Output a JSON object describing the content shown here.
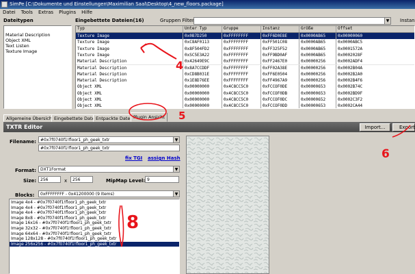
{
  "window": {
    "title": "SimPe [C:\\Dokumente und Einstellungen\\Maximilian Saal\\Desktop\\4_new_floors.package]"
  },
  "menu": [
    "Datei",
    "Tools",
    "Extras",
    "Plugins",
    "Hilfe"
  ],
  "left_panel": {
    "header": "Dateitypen",
    "items": [
      "Material Description",
      "Object XML",
      "Text Listen",
      "Texture Image"
    ]
  },
  "resources": {
    "header": "Eingebettete Dateien",
    "count": "(16)",
    "filter_label": "Gruppen Filter:",
    "filter_value": "",
    "right_label": "Instanz",
    "columns": [
      "Typ",
      "Unter Typ",
      "Gruppe",
      "Instanz",
      "Größe",
      "Offset"
    ],
    "rows": [
      [
        "Texture Image",
        "0x0B7D250",
        "0xFFFFFFFF",
        "0xFF6D0E8E",
        "0x0000AB65",
        "0x00000060"
      ],
      [
        "Texture Image",
        "0xC8AF0113",
        "0xFFFFFFFF",
        "0xFF501C08",
        "0x0000AB65",
        "0x0000ABC5"
      ],
      [
        "Texture Image",
        "0x8F504FD2",
        "0xFFFFFFFF",
        "0xFF325F52",
        "0x0000AB65",
        "0x0001572A"
      ],
      [
        "Texture Image",
        "0xSC5E3A22",
        "0xFFFFFFFF",
        "0xFF9BD0AF",
        "0x0000AB65",
        "0x0002028F"
      ],
      [
        "Material Description",
        "0x42649E9C",
        "0xFFFFFFFF",
        "0xFF2467E0",
        "0x00000256",
        "0x0002ADF4"
      ],
      [
        "Material Description",
        "0x8A7CCDDF",
        "0xFFFFFFFF",
        "0xFF02A38E",
        "0x00000256",
        "0x0002B04A"
      ],
      [
        "Material Description",
        "0xCD8B031E",
        "0xFFFFFFFF",
        "0xFF6E0504",
        "0x00000256",
        "0x0002B2A0"
      ],
      [
        "Material Description",
        "0x1E8D76EE",
        "0xFFFFFFFF",
        "0xFF4967A9",
        "0x00000256",
        "0x0002B4F6"
      ],
      [
        "Object XML",
        "0x00000000",
        "0x4C8CC5C0",
        "0xFCCOF0DE",
        "0x00000653",
        "0x0002B74C"
      ],
      [
        "Object XML",
        "0x00000000",
        "0x4C8CC5C0",
        "0xFCCOF0DB",
        "0x00000653",
        "0x0002BD9F"
      ],
      [
        "Object XML",
        "0x00000000",
        "0x4C8CC5C0",
        "0xFCCOF0DC",
        "0x00000652",
        "0x0002C3F2"
      ],
      [
        "Object XML",
        "0x00000000",
        "0x4C8CC5C0",
        "0xFCCOF0DD",
        "0x00000653",
        "0x0002CA44"
      ]
    ]
  },
  "tabs": [
    "Allgemeine Übersicht",
    "Eingebettete Datei",
    "Entpackte Datei",
    "Plugin Ansicht"
  ],
  "editor": {
    "title": "TXTR Editor",
    "import_label": "Import...",
    "export_label": "Export",
    "filename_label": "Filename:",
    "filename_value": "#0x7f0740f1!floor1_ph_geek_txtr",
    "filename_value2": "#0x7f0740f1!floor1_ph_geek_txtr",
    "fix_tgi": "fix TGI",
    "assign_hash": "assign Hash",
    "format_label": "Format:",
    "format_value": "DXT1Format",
    "size_label": "Size:",
    "size_w": "256",
    "size_x": "x",
    "size_h": "256",
    "mipmap_label": "MipMap Level:",
    "mipmap_value": "9",
    "blocks_label": "Blocks:",
    "blocks_value": "0xFFFFFFFF - 0x41200000 (9 Items)",
    "block_items": [
      "Image 4x4 - #0x7f0740f1!floor1_ph_geek_txtr",
      "Image 4x4 - #0x7f0740f1!floor1_ph_geek_txtr",
      "Image 4x4 - #0x7f0740f1!floor1_ph_geek_txtr",
      "Image 8x8 - #0x7f0740f1!floor1_ph_geek_txtr",
      "Image 16x16 - #0x7f0740f1!floor1_ph_geek_txtr",
      "Image 32x32 - #0x7f0740f1!floor1_ph_geek_txtr",
      "Image 64x64 - #0x7f0740f1!floor1_ph_geek_txtr",
      "Image 128x128 - #0x7f0740f1!floor1_ph_geek_txtr",
      "Image 256x256 - #0x7f0740f1!floor1_ph_geek_txtr"
    ]
  },
  "annotations": {
    "a4": "4",
    "a5": "5",
    "a6": "6",
    "a8": "8"
  },
  "colors": {
    "selection": "#0a246a",
    "annotation": "#e8141b",
    "titlebar": "#0a246a"
  }
}
